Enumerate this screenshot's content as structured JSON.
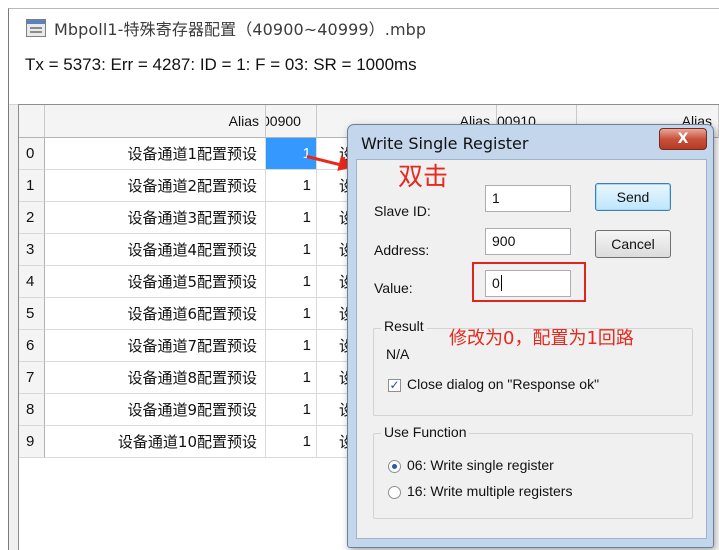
{
  "window": {
    "title": "Mbpoll1-特殊寄存器配置（40900~40999）.mbp",
    "status_line": "Tx = 5373: Err = 4287: ID = 1: F = 03: SR = 1000ms"
  },
  "grid": {
    "headers": [
      "Alias",
      "00900",
      "Alias",
      "00910",
      "Alias"
    ],
    "rows": [
      {
        "index": "0",
        "alias": "设备通道1配置预设",
        "value": "1",
        "alias2": "设备"
      },
      {
        "index": "1",
        "alias": "设备通道2配置预设",
        "value": "1",
        "alias2": "设备"
      },
      {
        "index": "2",
        "alias": "设备通道3配置预设",
        "value": "1",
        "alias2": "设备"
      },
      {
        "index": "3",
        "alias": "设备通道4配置预设",
        "value": "1",
        "alias2": "设备"
      },
      {
        "index": "4",
        "alias": "设备通道5配置预设",
        "value": "1",
        "alias2": "设备"
      },
      {
        "index": "5",
        "alias": "设备通道6配置预设",
        "value": "1",
        "alias2": "设备"
      },
      {
        "index": "6",
        "alias": "设备通道7配置预设",
        "value": "1",
        "alias2": "设备"
      },
      {
        "index": "7",
        "alias": "设备通道8配置预设",
        "value": "1",
        "alias2": "设备"
      },
      {
        "index": "8",
        "alias": "设备通道9配置预设",
        "value": "1",
        "alias2": "设备"
      },
      {
        "index": "9",
        "alias": "设备通道10配置预设",
        "value": "1",
        "alias2": "设备"
      }
    ],
    "selected_color": "#3399ff"
  },
  "dialog": {
    "title": "Write Single Register",
    "close_label": "X",
    "slave_id_label": "Slave ID:",
    "slave_id_value": "1",
    "address_label": "Address:",
    "address_value": "900",
    "value_label": "Value:",
    "value_value": "0",
    "send_label": "Send",
    "cancel_label": "Cancel",
    "result_title": "Result",
    "result_value": "N/A",
    "close_on_ok_label": "Close dialog on \"Response ok\"",
    "close_on_ok_checked": true,
    "use_function_title": "Use Function",
    "function_options": [
      "06: Write single register",
      "16: Write multiple registers"
    ],
    "function_selected": "06: Write single register"
  },
  "annotations": {
    "double_click": "双击",
    "note": "修改为0，配置为1回路",
    "color": "#e8281c"
  }
}
